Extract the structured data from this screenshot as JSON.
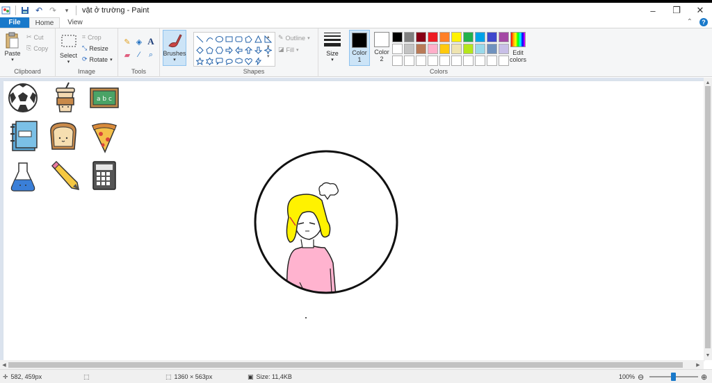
{
  "window": {
    "title": "vật ở trường - Paint"
  },
  "menu": {
    "file": "File",
    "home": "Home",
    "view": "View"
  },
  "clipboard": {
    "paste": "Paste",
    "cut": "Cut",
    "copy": "Copy",
    "label": "Clipboard"
  },
  "image": {
    "select": "Select",
    "crop": "Crop",
    "resize": "Resize",
    "rotate": "Rotate",
    "label": "Image"
  },
  "tools": {
    "label": "Tools"
  },
  "brushes": {
    "label": "Brushes"
  },
  "shapes": {
    "outline": "Outline",
    "fill": "Fill",
    "label": "Shapes"
  },
  "size": {
    "label": "Size"
  },
  "colors": {
    "color1_label": "Color",
    "color1_num": "1",
    "color2_label": "Color",
    "color2_num": "2",
    "color1": "#000000",
    "color2": "#ffffff",
    "edit_label": "Edit",
    "edit_label2": "colors",
    "label": "Colors",
    "palette": [
      "#000000",
      "#7f7f7f",
      "#880015",
      "#ed1c24",
      "#ff7f27",
      "#fff200",
      "#22b14c",
      "#00a2e8",
      "#3f48cc",
      "#a349a4",
      "#ffffff",
      "#c3c3c3",
      "#b97a57",
      "#ffaec9",
      "#ffc90e",
      "#efe4b0",
      "#b5e61d",
      "#99d9ea",
      "#7092be",
      "#c8bfe7",
      "#ffffff",
      "#ffffff",
      "#ffffff",
      "#ffffff",
      "#ffffff",
      "#ffffff",
      "#ffffff",
      "#ffffff",
      "#ffffff",
      "#ffffff"
    ]
  },
  "status": {
    "cursor_pos": "582, 459px",
    "dimensions": "1360 × 563px",
    "file_size": "Size: 11,4KB",
    "zoom": "100%"
  },
  "icons": [
    "soccer-ball-icon",
    "coffee-cup-icon",
    "chalkboard-icon",
    "notebook-icon",
    "bread-icon",
    "pizza-icon",
    "flask-icon",
    "pencil-icon",
    "calculator-icon"
  ],
  "chalkboard_text": "a b c"
}
